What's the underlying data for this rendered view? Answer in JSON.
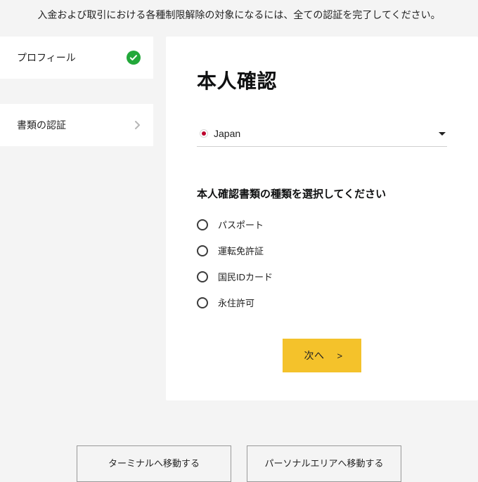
{
  "intro": "入金および取引における各種制限解除の対象になるには、全ての認証を完了してください。",
  "sidebar": {
    "items": [
      {
        "label": "プロフィール",
        "status": "done"
      },
      {
        "label": "書類の認証",
        "status": "next"
      }
    ]
  },
  "card": {
    "title": "本人確認",
    "country": {
      "name": "Japan",
      "code": "JP"
    },
    "doc_section_label": "本人確認書類の種類を選択してください",
    "doc_options": [
      {
        "label": "パスポート"
      },
      {
        "label": "運転免許証"
      },
      {
        "label": "国民IDカード"
      },
      {
        "label": "永住許可"
      }
    ],
    "next_label": "次へ"
  },
  "footer": {
    "terminal_btn": "ターミナルへ移動する",
    "personal_btn": "パーソナルエリアへ移動する"
  },
  "colors": {
    "accent": "#f4c22b",
    "success": "#22a83a",
    "text": "#222222",
    "bg": "#f4f4f4"
  }
}
